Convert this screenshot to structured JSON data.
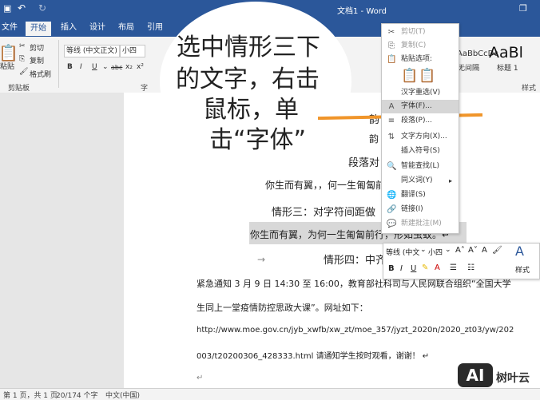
{
  "titlebar": {
    "title": "文档1 - Word"
  },
  "tabs": [
    "文件",
    "开始",
    "插入",
    "设计",
    "布局",
    "引用"
  ],
  "clipboard": {
    "cut": "剪切",
    "copy": "复制",
    "format_painter": "格式刷",
    "paste": "粘贴",
    "group_label": "剪贴板"
  },
  "font": {
    "name": "等线 (中文正文)",
    "size": "小四",
    "group_label": "字"
  },
  "styles": {
    "sample1": "AaBbCcDc",
    "label1": "无间隔",
    "sample2": "AaBl",
    "label2": "标题 1",
    "group_label": "样式"
  },
  "bubble": {
    "line1": "选中情形三下",
    "line2": "的文字，右击",
    "line3": "鼠标，单",
    "line4": "击“字体”"
  },
  "context_menu": {
    "items": [
      {
        "icon": "✂",
        "label": "剪切(T)",
        "disabled": true
      },
      {
        "icon": "⎘",
        "label": "复制(C)",
        "disabled": true
      },
      {
        "icon": "📋",
        "label": "粘贴选项:",
        "disabled": false
      },
      {
        "icon": "",
        "label": "汉字重选(V)",
        "disabled": false
      },
      {
        "icon": "A",
        "label": "字体(F)...",
        "disabled": false,
        "highlighted": true
      },
      {
        "icon": "≡",
        "label": "段落(P)...",
        "disabled": false
      },
      {
        "icon": "⇅",
        "label": "文字方向(X)...",
        "disabled": false
      },
      {
        "icon": "",
        "label": "插入符号(S)",
        "disabled": false
      },
      {
        "icon": "🔍",
        "label": "智能查找(L)",
        "disabled": false
      },
      {
        "icon": "",
        "label": "同义词(Y)",
        "disabled": false
      },
      {
        "icon": "🌐",
        "label": "翻译(S)",
        "disabled": false
      },
      {
        "icon": "🔗",
        "label": "链接(I)",
        "disabled": false
      },
      {
        "icon": "💬",
        "label": "新建批注(M)",
        "disabled": true
      }
    ]
  },
  "mini_toolbar": {
    "font": "等线 (中文",
    "size": "小四",
    "styles_label": "样式"
  },
  "document": {
    "heading_partial": "韵",
    "subheading_partial": "段落对",
    "line1": "你生而有翼，，何一生匍匐前",
    "case3_label": "情形三：对字符间距做",
    "selected_line": "你生而有翼，为何一生匍匐前行，形如虫蚁。↵",
    "case4_label": "情形四：中齐",
    "para1": "紧急通知 3 月 9 日 14:30 至 16:00，教育部社科司与人民网联合组织“全国大学",
    "para2": "生同上一堂疫情防控思政大课”。网址如下：",
    "url1": "http://www.moe.gov.cn/jyb_xwfb/xw_zt/moe_357/jyzt_2020n/2020_zt03/yw/202",
    "url2": "003/t20200306_428333.html 请通知学生按时观看，谢谢！ ↵"
  },
  "statusbar": {
    "page": "第 1 页，共 1 页",
    "words": "20/174 个字",
    "lang": "中文(中国)"
  },
  "watermark": {
    "logo": "AI",
    "text": "树叶云"
  }
}
